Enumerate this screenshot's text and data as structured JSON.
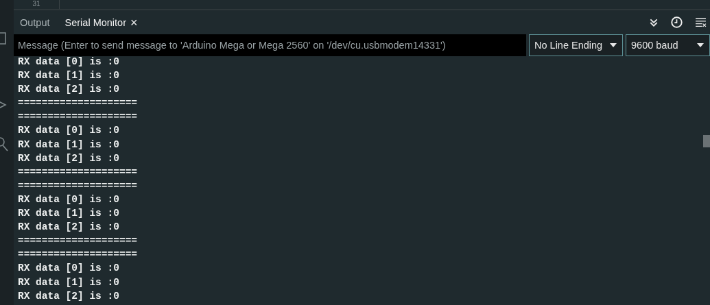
{
  "editor": {
    "line_number": "31"
  },
  "panel_tabs": [
    {
      "label": "Output",
      "selected": false
    },
    {
      "label": "Serial Monitor",
      "selected": true,
      "close": "×"
    }
  ],
  "message_field": {
    "placeholder": "Message (Enter to send message to 'Arduino Mega or Mega 2560' on '/dev/cu.usbmodem14331')"
  },
  "line_ending": {
    "value": "No Line Ending"
  },
  "baud_rate": {
    "value": "9600 baud"
  },
  "output_lines": [
    "RX data [0] is :0",
    "RX data [1] is :0",
    "RX data [2] is :0",
    "====================",
    "====================",
    "RX data [0] is :0",
    "RX data [1] is :0",
    "RX data [2] is :0",
    "====================",
    "====================",
    "RX data [0] is :0",
    "RX data [1] is :0",
    "RX data [2] is :0",
    "====================",
    "====================",
    "RX data [0] is :0",
    "RX data [1] is :0",
    "RX data [2] is :0"
  ]
}
